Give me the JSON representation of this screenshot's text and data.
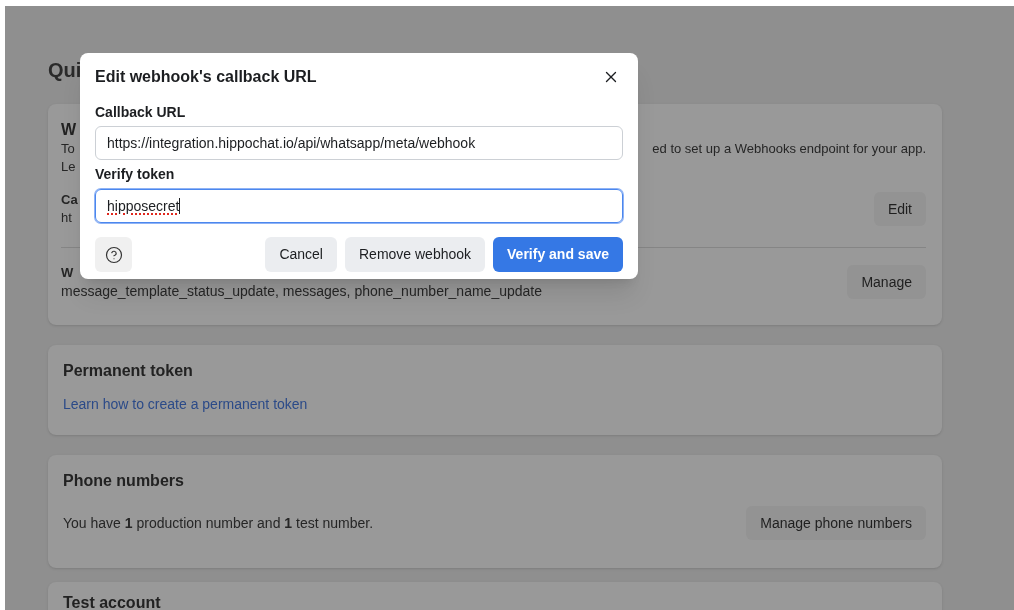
{
  "page": {
    "heading": "Qui"
  },
  "webhook_card": {
    "title": "W",
    "description_start": "To",
    "description_end": "ed to set up a Webhooks endpoint for your app.",
    "line_3": "Le",
    "callback_label": "Ca",
    "callback_value": "ht",
    "edit_button": "Edit",
    "fields_label": "W",
    "fields_value": "message_template_status_update, messages, phone_number_name_update",
    "manage_button": "Manage"
  },
  "permanent_token_card": {
    "title": "Permanent token",
    "link": "Learn how to create a permanent token"
  },
  "phone_numbers_card": {
    "title": "Phone numbers",
    "summary": "You have **1** production number and **1** test number.",
    "button": "Manage phone numbers"
  },
  "test_account_card": {
    "title": "Test account"
  },
  "dialog": {
    "title": "Edit webhook's callback URL",
    "fields": [
      {
        "label": "Callback URL",
        "value": "https://integration.hippochat.io/api/whatsapp/meta/webhook",
        "focused": false,
        "misspelled": false
      },
      {
        "label": "Verify token",
        "value": "hipposecret",
        "focused": true,
        "misspelled": true
      }
    ],
    "buttons": [
      {
        "label": "Cancel",
        "kind": "secondary"
      },
      {
        "label": "Remove webhook",
        "kind": "secondary"
      },
      {
        "label": "Verify and save",
        "kind": "primary"
      }
    ]
  }
}
